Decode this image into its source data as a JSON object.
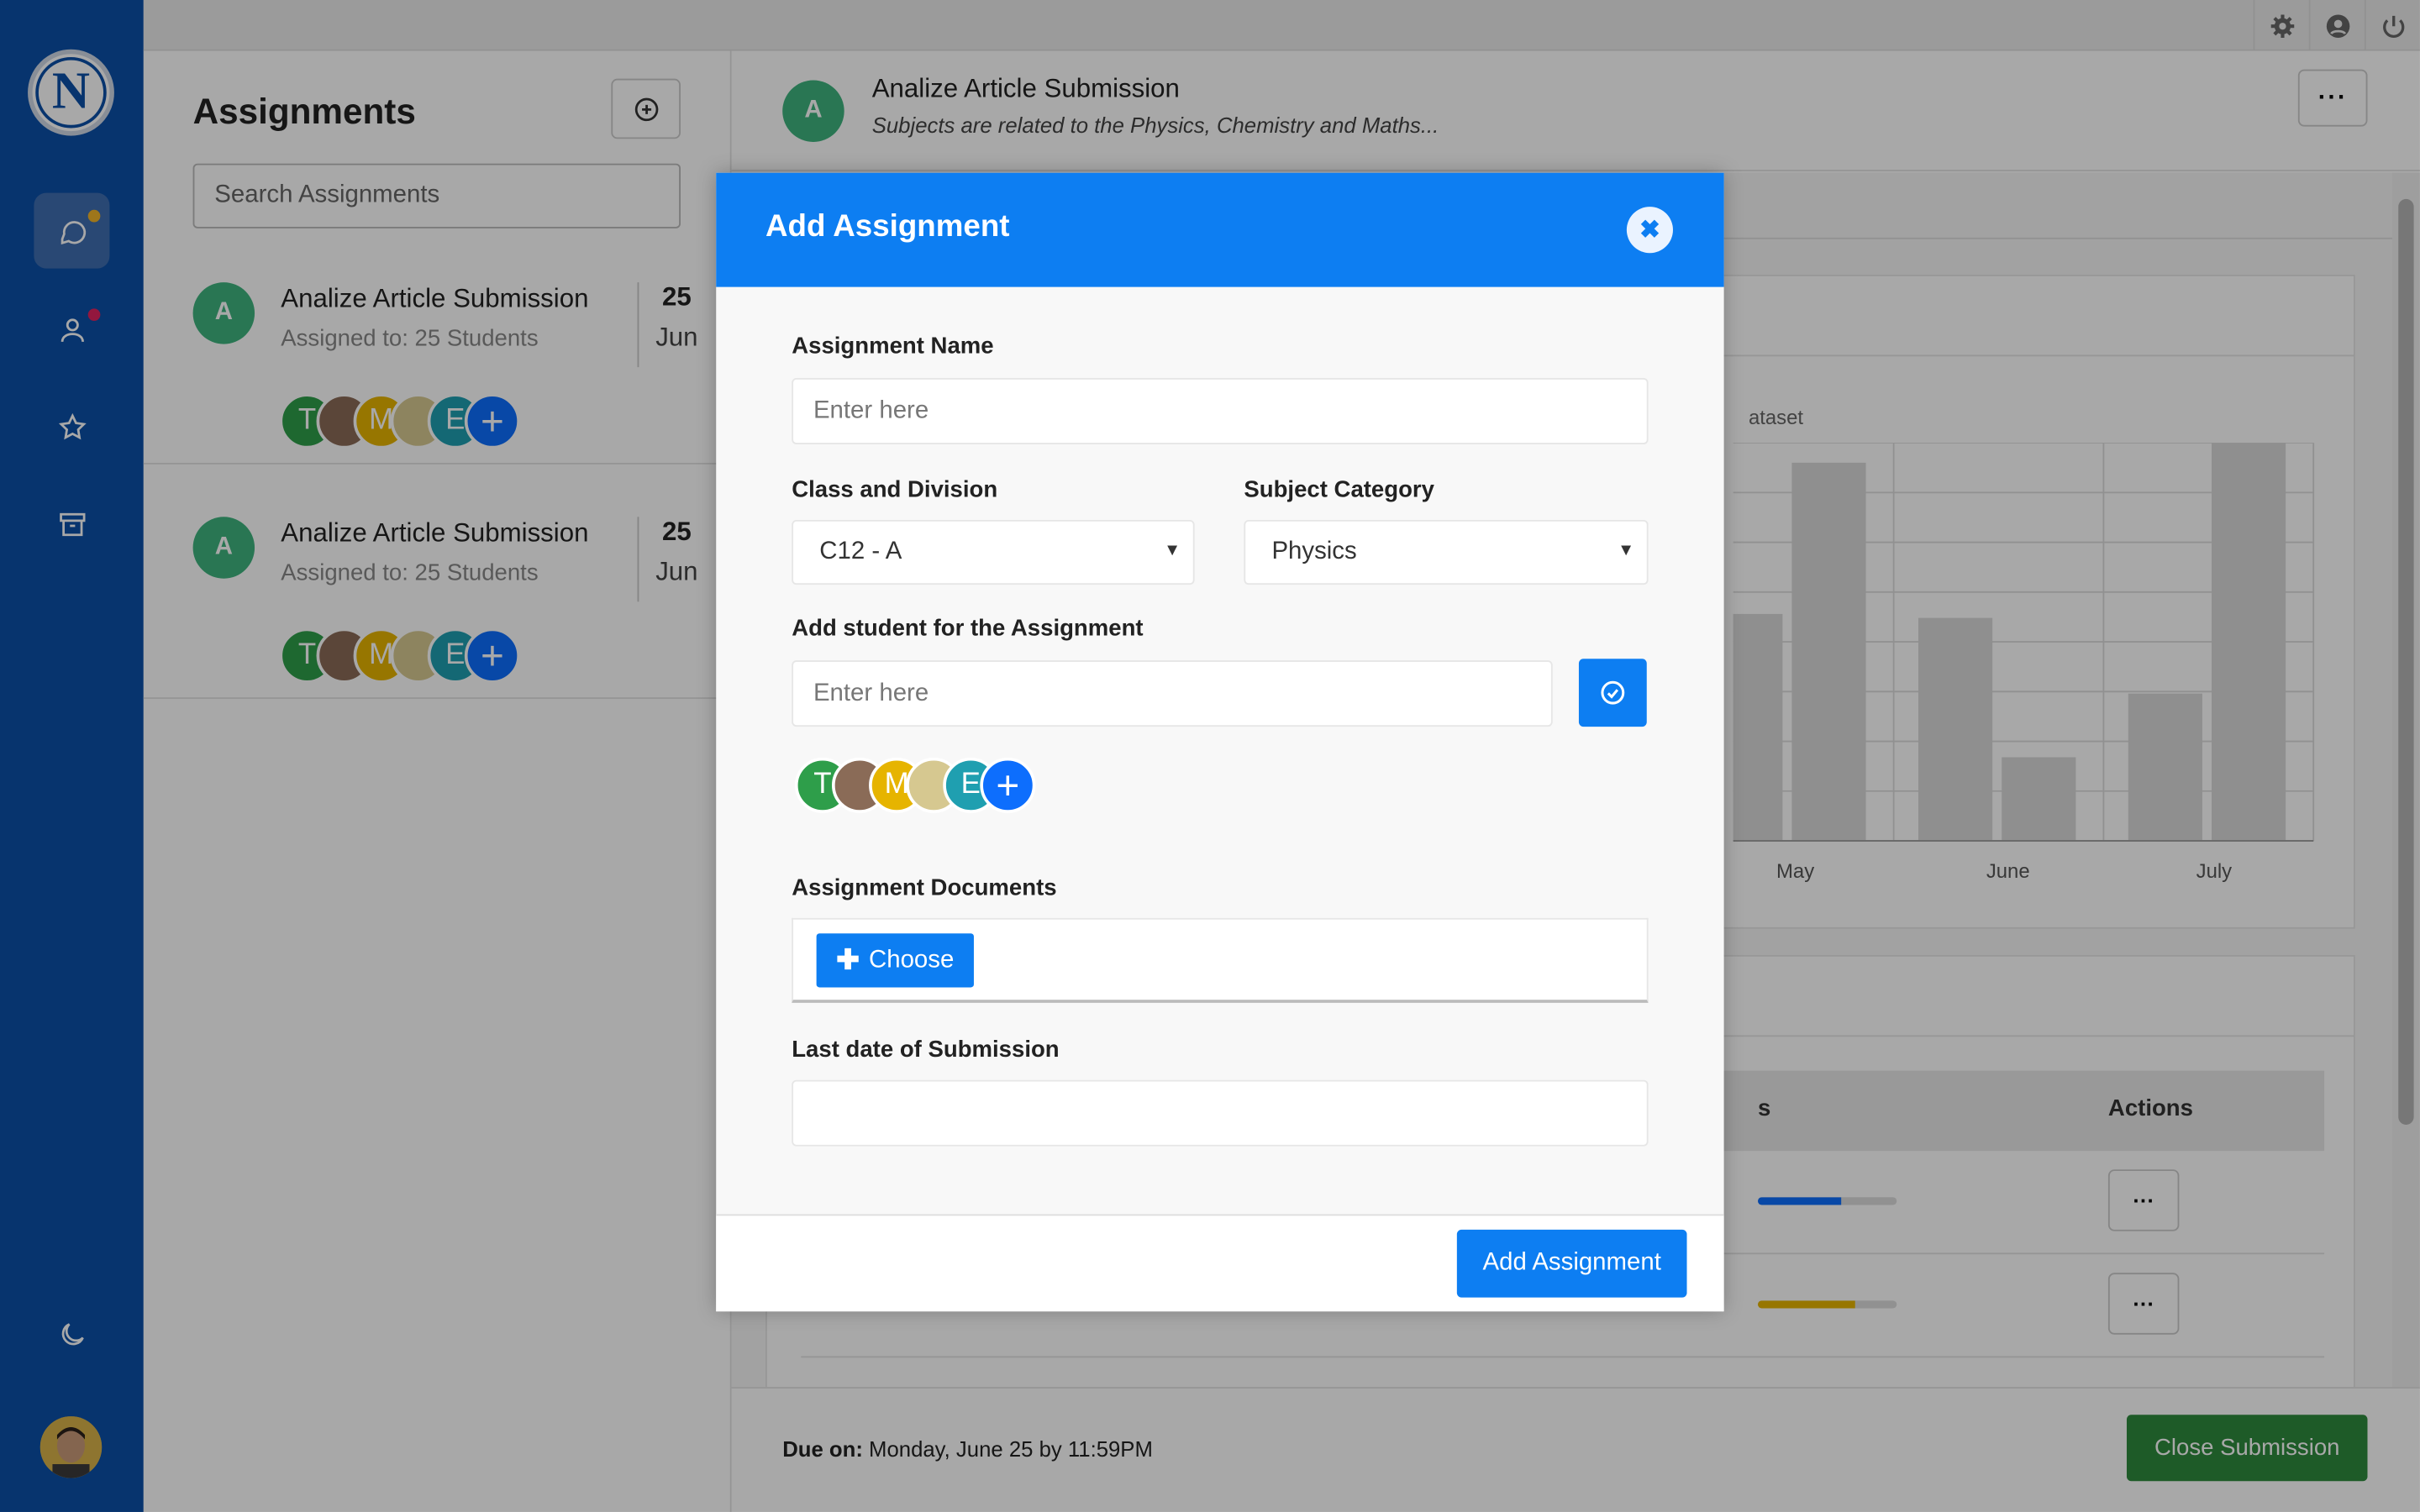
{
  "sidebar": {
    "logo_letter": "N",
    "accent": "#0b4fa8",
    "items": [
      {
        "icon": "chat-icon",
        "active": true,
        "badge_color": "#f0b429"
      },
      {
        "icon": "user-icon",
        "active": false,
        "badge_color": "#e0245e"
      },
      {
        "icon": "star-icon",
        "active": false
      },
      {
        "icon": "archive-icon",
        "active": false
      }
    ],
    "bottom": {
      "theme_icon": "moon-icon"
    }
  },
  "topbar": {
    "icons": [
      "gear-icon",
      "user-circle-icon",
      "power-icon"
    ]
  },
  "list": {
    "title": "Assignments",
    "search_placeholder": "Search Assignments",
    "items": [
      {
        "avatar": "A",
        "title": "Analize Article Submission",
        "subtitle": "Assigned to: 25 Students",
        "day": "25",
        "month": "Jun",
        "members": [
          "T",
          "",
          "M",
          "",
          "E"
        ]
      },
      {
        "avatar": "A",
        "title": "Analize Article Submission",
        "subtitle": "Assigned to: 25 Students",
        "day": "25",
        "month": "Jun",
        "members": [
          "T",
          "",
          "M",
          "",
          "E"
        ]
      }
    ]
  },
  "main": {
    "avatar": "A",
    "title": "Analize Article Submission",
    "subtitle": "Subjects are related to the Physics, Chemistry and Maths...",
    "chart_legend": "ataset",
    "table_header_partial": "s",
    "table_header_actions": "Actions",
    "due_label": "Due on:",
    "due_value": " Monday, June 25 by 11:59PM",
    "close_button": "Close Submission"
  },
  "chart_data": {
    "type": "bar",
    "categories": [
      "May",
      "June",
      "July"
    ],
    "series": [
      {
        "values": [
          57,
          56,
          37
        ]
      },
      {
        "values": [
          95,
          21,
          100
        ]
      }
    ],
    "ylim": [
      0,
      100
    ],
    "grid": true
  },
  "modal": {
    "title": "Add Assignment",
    "assignment_name_label": "Assignment Name",
    "assignment_name_placeholder": "Enter here",
    "class_label": "Class and Division",
    "class_value": "C12 - A",
    "subject_label": "Subject Category",
    "subject_value": "Physics",
    "student_label": "Add student for the Assignment",
    "student_placeholder": "Enter here",
    "students": [
      "T",
      "",
      "M",
      "",
      "E"
    ],
    "docs_label": "Assignment Documents",
    "choose_label": "Choose",
    "last_date_label": "Last date of Submission",
    "last_date_value": "",
    "submit_label": "Add Assignment"
  },
  "colors": {
    "primary": "#0d7ef2",
    "success": "#2e8b3e",
    "avatar_green": "#3fb47e",
    "member_green": "#2e9e4a",
    "member_yellow": "#e6b400",
    "member_teal": "#1f9fb0",
    "progress_blue": "#0d6efd",
    "progress_yellow": "#e6b400"
  }
}
